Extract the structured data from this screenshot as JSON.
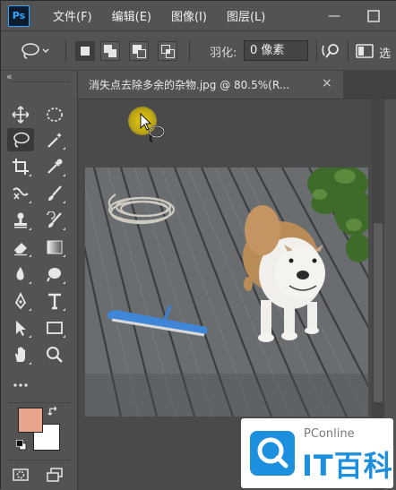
{
  "app": {
    "logo_text": "Ps",
    "accent_color": "#31a8ff"
  },
  "menu": {
    "items": [
      "文件(F)",
      "编辑(E)",
      "图像(I)",
      "图层(L)"
    ],
    "window_controls": [
      "minimize",
      "maximize"
    ]
  },
  "options": {
    "feather_label": "羽化:",
    "feather_value": "0 像素",
    "selection_modes": [
      "new-selection",
      "add-to-selection",
      "subtract-from-selection",
      "intersect-with-selection"
    ],
    "active_mode": "new-selection"
  },
  "document": {
    "tab_title": "消失点去除多余的杂物.jpg @ 80.5%(R..."
  },
  "toolbar": {
    "tools": [
      "move",
      "marquee",
      "lasso",
      "quick-selection",
      "crop",
      "eyedropper",
      "healing",
      "brush",
      "clone-stamp",
      "history-brush",
      "eraser",
      "gradient",
      "blur",
      "dodge",
      "pen",
      "type",
      "path-selection",
      "rectangle",
      "hand",
      "zoom",
      "more"
    ],
    "active_tool": "lasso",
    "foreground_color": "#e8a48c",
    "background_color": "#ffffff"
  },
  "watermark": {
    "brand_small": "PConline",
    "brand_big": "IT百科"
  }
}
